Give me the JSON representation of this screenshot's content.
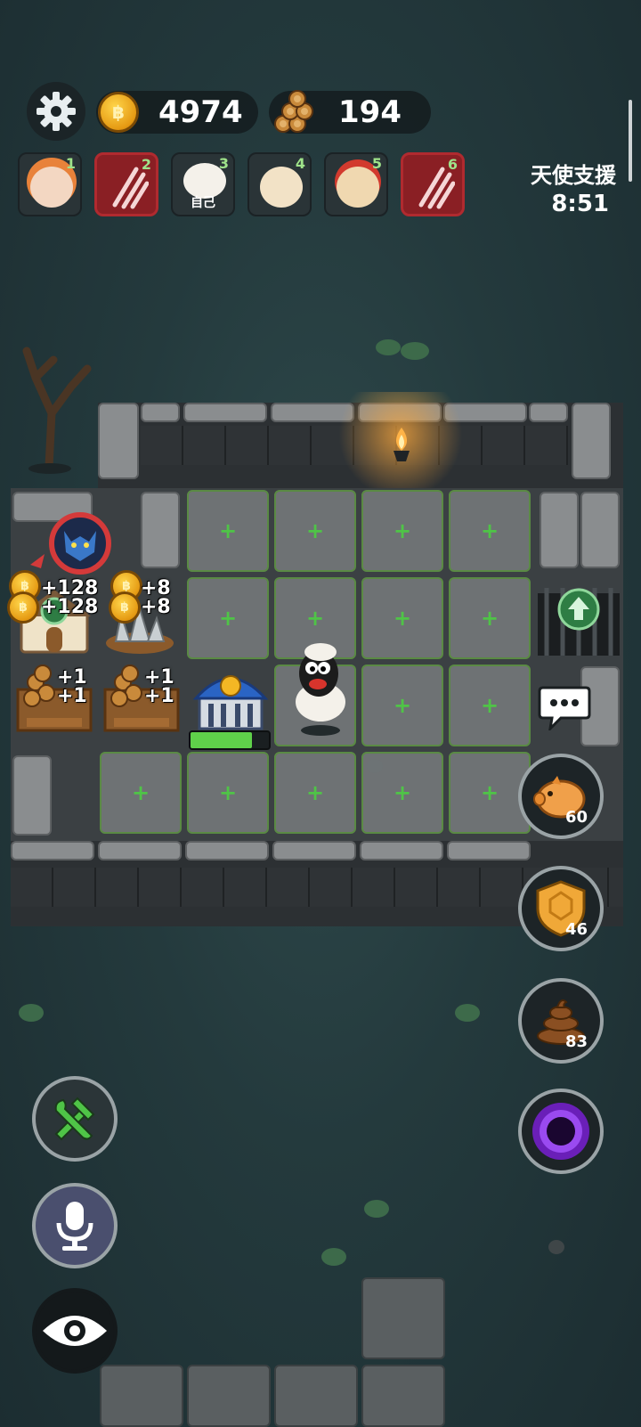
{
  "top_bar": {
    "coins": "4974",
    "wood": "194"
  },
  "players": [
    {
      "num": "1",
      "type": "ally"
    },
    {
      "num": "2",
      "type": "enemy"
    },
    {
      "num": "3",
      "type": "self",
      "label": "自己"
    },
    {
      "num": "4",
      "type": "ally"
    },
    {
      "num": "5",
      "type": "ally"
    },
    {
      "num": "6",
      "type": "enemy"
    }
  ],
  "angel_support": {
    "label": "天使支援",
    "timer": "8:51"
  },
  "board": {
    "bonuses": {
      "a": "+128",
      "b": "+128",
      "c": "+8",
      "d": "+8",
      "e": "+1",
      "f": "+1",
      "g": "+1",
      "h": "+1"
    },
    "tile_plus": "+"
  },
  "abilities": [
    {
      "name": "piggy-bank",
      "count": "60"
    },
    {
      "name": "shield",
      "count": "46"
    },
    {
      "name": "poop",
      "count": "83"
    },
    {
      "name": "portal",
      "count": ""
    }
  ],
  "colors": {
    "coin": "#f4b724",
    "tile_plus": "#4fc447",
    "progress": "#5fd14a",
    "enemy_slot": "#8a1f24"
  },
  "build_progress": 0.78
}
